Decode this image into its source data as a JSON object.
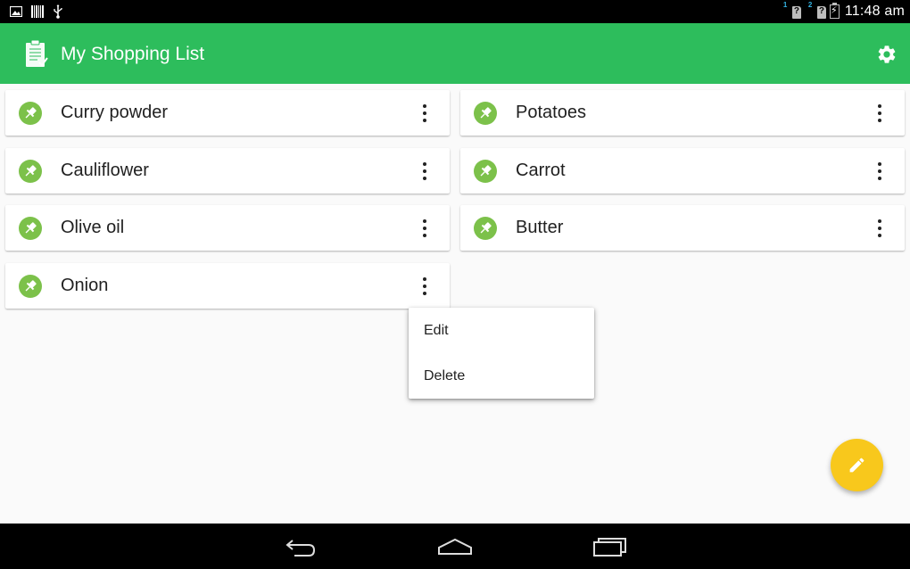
{
  "status_bar": {
    "sim1_number": "1",
    "sim2_number": "2",
    "time": "11:48 am"
  },
  "app_bar": {
    "title": "My Shopping List",
    "icon": "clipboard-icon",
    "settings_icon": "gear-icon",
    "color": "#2dbd5c"
  },
  "items": {
    "left": [
      {
        "label": "Curry powder"
      },
      {
        "label": "Cauliflower"
      },
      {
        "label": "Olive oil"
      },
      {
        "label": "Onion"
      }
    ],
    "right": [
      {
        "label": "Potatoes"
      },
      {
        "label": "Carrot"
      },
      {
        "label": "Butter"
      }
    ],
    "pin_color": "#7cc14a"
  },
  "popup_menu": {
    "edit_label": "Edit",
    "delete_label": "Delete"
  },
  "fab": {
    "icon": "pencil-icon",
    "color": "#f8c81c"
  },
  "nav_bar": {
    "back_icon": "back-icon",
    "home_icon": "home-icon",
    "recents_icon": "recents-icon"
  }
}
